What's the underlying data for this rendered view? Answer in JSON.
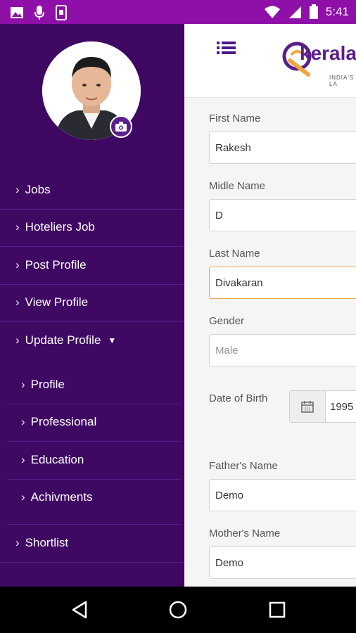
{
  "status_bar": {
    "time": "5:41",
    "icons_left": [
      "image-icon",
      "mic-icon",
      "phone-device-icon"
    ],
    "icons_right": [
      "wifi-icon",
      "signal-icon",
      "battery-icon"
    ]
  },
  "app": {
    "logo_text": "kerala",
    "logo_tagline": "INDIA'S LA"
  },
  "drawer": {
    "items": [
      {
        "label": "Jobs"
      },
      {
        "label": "Hoteliers Job"
      },
      {
        "label": "Post Profile"
      },
      {
        "label": "View Profile"
      },
      {
        "label": "Update Profile"
      }
    ],
    "sub_items": [
      {
        "label": "Profile"
      },
      {
        "label": "Professional"
      },
      {
        "label": "Education"
      },
      {
        "label": "Achivments"
      }
    ],
    "bottom_items": [
      {
        "label": "Shortlist"
      }
    ]
  },
  "form": {
    "first_name": {
      "label": "First Name",
      "value": "Rakesh"
    },
    "middle_name": {
      "label": "Midle Name",
      "value": "D"
    },
    "last_name": {
      "label": "Last Name",
      "value": "Divakaran"
    },
    "gender": {
      "label": "Gender",
      "value": "Male"
    },
    "dob": {
      "label": "Date of Birth",
      "value": "1995"
    },
    "father_name": {
      "label": "Father's Name",
      "value": "Demo"
    },
    "mother_name": {
      "label": "Mother's Name",
      "value": "Demo"
    }
  },
  "colors": {
    "status_bar": "#8e10a8",
    "drawer_bg": "#3f0963",
    "accent": "#5b1f8b",
    "focus": "#f0a640"
  }
}
